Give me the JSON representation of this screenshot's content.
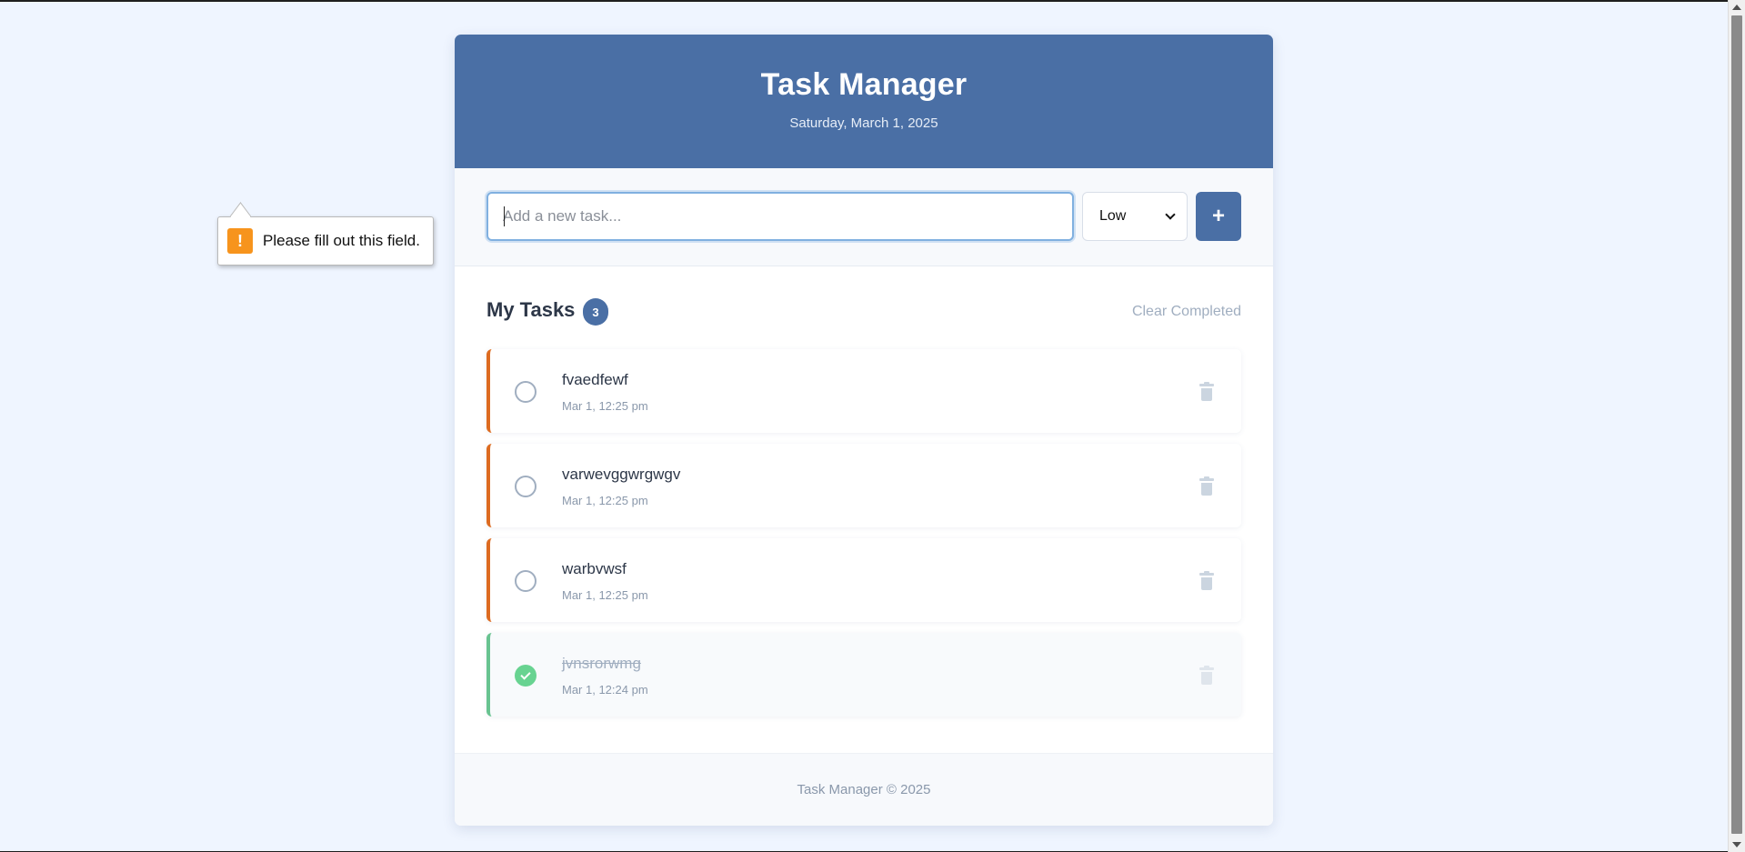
{
  "header": {
    "title": "Task Manager",
    "date": "Saturday, March 1, 2025"
  },
  "input": {
    "placeholder": "Add a new task...",
    "value": ""
  },
  "priority": {
    "selected": "Low"
  },
  "add_button": {
    "label": "+"
  },
  "validation": {
    "icon": "!",
    "message": "Please fill out this field."
  },
  "tasks_section": {
    "title": "My Tasks",
    "count": "3",
    "clear_label": "Clear Completed"
  },
  "tasks": [
    {
      "text": "fvaedfewf",
      "time": "Mar 1, 12:25 pm",
      "completed": false
    },
    {
      "text": "varwevggwrgwgv",
      "time": "Mar 1, 12:25 pm",
      "completed": false
    },
    {
      "text": "warbvwsf",
      "time": "Mar 1, 12:25 pm",
      "completed": false
    },
    {
      "text": "jvnsrorwmg",
      "time": "Mar 1, 12:24 pm",
      "completed": true
    }
  ],
  "footer": {
    "text": "Task Manager © 2025"
  },
  "colors": {
    "accent": "#4a6fa5",
    "priority_border": "#dd6b20",
    "completed_border": "#68c390",
    "background": "#eff5ff"
  }
}
